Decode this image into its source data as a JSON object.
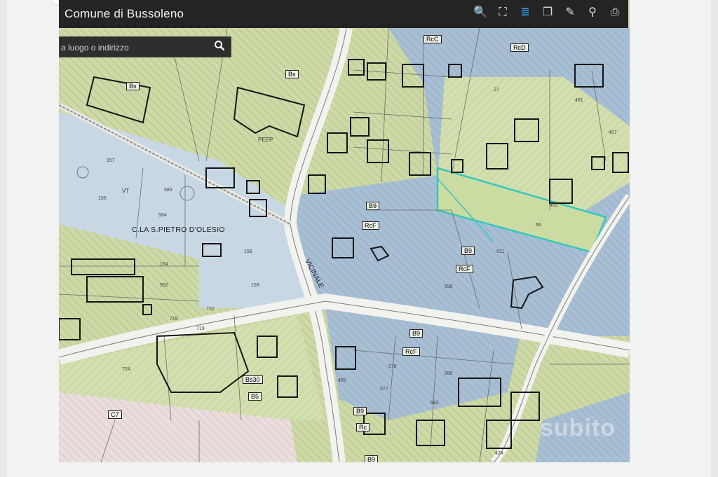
{
  "app": {
    "title": "Comune di Bussoleno"
  },
  "toolbar": {
    "tools": [
      {
        "name": "zoom-icon",
        "glyph": "🔍"
      },
      {
        "name": "binoculars-icon",
        "glyph": "⛶"
      },
      {
        "name": "layers-icon",
        "glyph": "≣"
      },
      {
        "name": "copy-icon",
        "glyph": "❐"
      },
      {
        "name": "eraser-icon",
        "glyph": "✎"
      },
      {
        "name": "measure-icon",
        "glyph": "⚲"
      },
      {
        "name": "print-icon",
        "glyph": "⎙"
      }
    ]
  },
  "search": {
    "placeholder": "a luogo o indirizzo",
    "icon": "search-icon"
  },
  "colors": {
    "green_zone": "#c8d79c",
    "blue_zone": "#9fb8cf",
    "light_blue_zone": "#c3d3e1",
    "pink_zone": "#e4d4d4",
    "road": "#f2f3f0",
    "highlight": "#35c7bf"
  },
  "map": {
    "street_labels": [
      "C.LA S.PIETRO D'OLESIO",
      "VICINALE"
    ],
    "zone_labels": [
      "Bs",
      "B9",
      "RcF",
      "Rc",
      "RcD",
      "RcC",
      "Bs30",
      "C7",
      "PEEP",
      "VT",
      "B5"
    ],
    "parcel_numbers": [
      "157",
      "155",
      "583",
      "564",
      "158",
      "159",
      "154",
      "552",
      "719",
      "724",
      "586",
      "585",
      "577",
      "578",
      "582",
      "455",
      "424",
      "598",
      "611",
      "66",
      "465",
      "27",
      "491",
      "497",
      "719",
      "720"
    ]
  },
  "watermark": {
    "text": "subito"
  }
}
